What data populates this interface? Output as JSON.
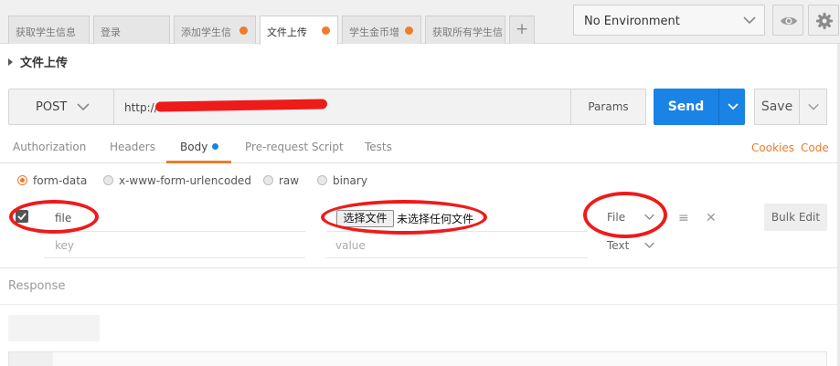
{
  "tabs": [
    {
      "label": "获取学生信息",
      "active": false,
      "dot": false
    },
    {
      "label": "登录",
      "active": false,
      "dot": false
    },
    {
      "label": "添加学生信",
      "active": false,
      "dot": true
    },
    {
      "label": "文件上传",
      "active": true,
      "dot": true
    },
    {
      "label": "学生金币增",
      "active": false,
      "dot": true
    },
    {
      "label": "获取所有学生信",
      "active": false,
      "dot": false
    }
  ],
  "tab_add_label": "+",
  "environment": {
    "selected": "No Environment"
  },
  "icons": {
    "eye": "eye-icon",
    "settings": "gear-icon",
    "add": "plus-icon"
  },
  "request": {
    "name": "文件上传",
    "method": "POST",
    "url": "http://",
    "params_label": "Params",
    "send_label": "Send",
    "save_label": "Save"
  },
  "request_tabs": {
    "authorization": "Authorization",
    "headers": "Headers",
    "body": "Body",
    "pre_request_script": "Pre-request Script",
    "tests": "Tests"
  },
  "links": {
    "cookies": "Cookies",
    "code": "Code"
  },
  "body_modes": {
    "form_data": "form-data",
    "urlencoded": "x-www-form-urlencoded",
    "raw": "raw",
    "binary": "binary",
    "selected": "form-data"
  },
  "form_rows": [
    {
      "key": "file",
      "choose_file_label": "选择文件",
      "no_file_label": "未选择任何文件",
      "type": "File",
      "checked": true
    },
    {
      "key_placeholder": "key",
      "value_placeholder": "value",
      "type": "Text"
    }
  ],
  "bulk_edit_label": "Bulk Edit",
  "response": {
    "label": "Response"
  },
  "colors": {
    "accent": "#f07b2b",
    "send_blue": "#1a84e6",
    "annotation_red": "#ee1b1b"
  }
}
